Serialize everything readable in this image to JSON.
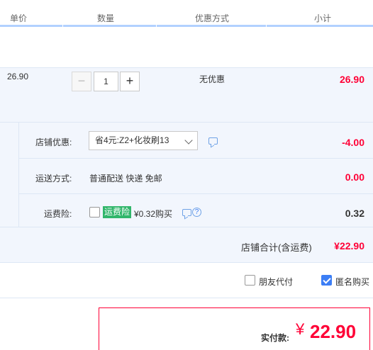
{
  "header": {
    "col_price": "单价",
    "col_qty": "数量",
    "col_promo": "优惠方式",
    "col_subtotal": "小计"
  },
  "item": {
    "price": "26.90",
    "quantity": "1",
    "minus": "−",
    "plus": "+",
    "promo": "无优惠",
    "subtotal": "26.90"
  },
  "shop": {
    "discount_label": "店铺优惠:",
    "discount_select": "省4元:Z2+化妆刷13",
    "discount_amount": "-4.00",
    "shipping_label": "运送方式:",
    "shipping_value": "普通配送 快递 免邮",
    "shipping_amount": "0.00",
    "insurance_label": "运费险:",
    "insurance_badge": "运费险",
    "insurance_price": "¥0.32购买",
    "insurance_amount": "0.32",
    "total_label": "店铺合计(含运费)",
    "total_amount": "¥22.90"
  },
  "options": {
    "friend_pay": "朋友代付",
    "anonymous": "匿名购买",
    "anonymous_checked": true
  },
  "payment": {
    "label": "实付款:",
    "currency": "¥",
    "amount": "22.90"
  },
  "colors": {
    "accent_red": "#ff0036",
    "accent_blue": "#3c7ef5",
    "row_bg": "#f2f6fd",
    "badge_green": "#31b66b"
  }
}
